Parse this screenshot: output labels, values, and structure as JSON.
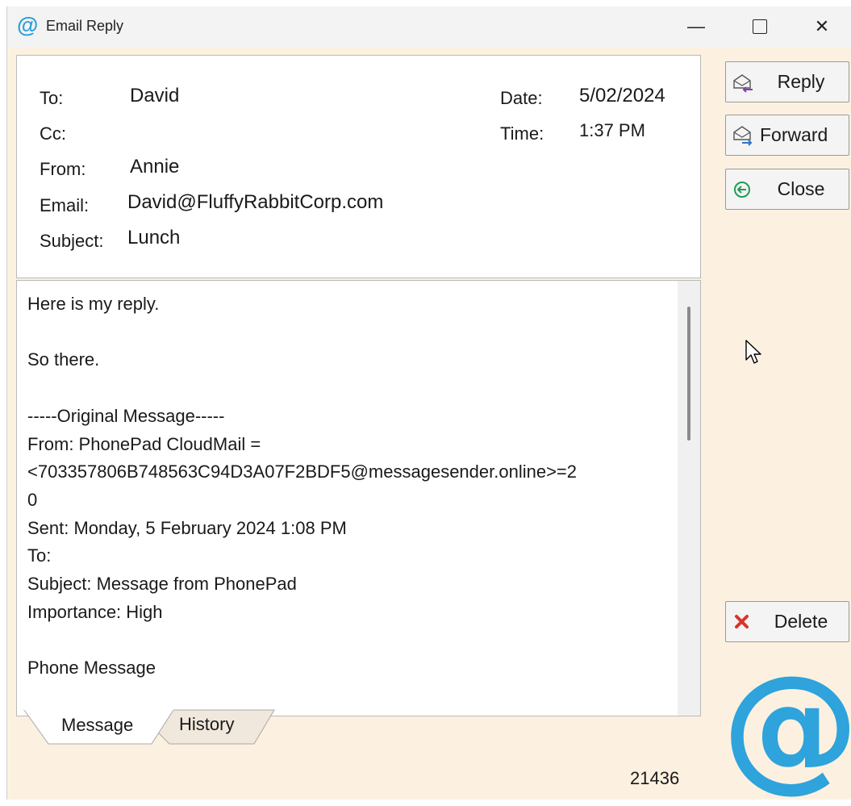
{
  "window": {
    "title": "Email Reply",
    "controls": {
      "minimize": "—",
      "close": "✕"
    }
  },
  "header": {
    "to_label": "To:",
    "to_value": "David",
    "cc_label": "Cc:",
    "cc_value": "",
    "from_label": "From:",
    "from_value": "Annie",
    "email_label": "Email:",
    "email_value": "David@FluffyRabbitCorp.com",
    "subject_label": "Subject:",
    "subject_value": "Lunch",
    "date_label": "Date:",
    "date_value": "5/02/2024",
    "time_label": "Time:",
    "time_value": "1:37 PM"
  },
  "message": {
    "body": "Here is my reply.\n\nSo there.\n\n-----Original Message-----\nFrom: PhonePad CloudMail =\n<703357806B748563C94D3A07F2BDF5@messagesender.online>=2\n0\nSent: Monday, 5 February 2024 1:08 PM\nTo:\nSubject: Message from PhonePad\nImportance: High\n\nPhone Message"
  },
  "tabs": [
    {
      "label": "Message",
      "active": true
    },
    {
      "label": "History",
      "active": false
    }
  ],
  "actions": {
    "reply": "Reply",
    "forward": "Forward",
    "close": "Close",
    "delete": "Delete"
  },
  "icons": {
    "app": "at-sign-icon",
    "reply": "envelope-reply-icon",
    "forward": "envelope-forward-icon",
    "close": "circle-arrow-left-icon",
    "delete": "red-x-icon",
    "brand": "large-at-logo"
  },
  "colors": {
    "brand_blue": "#2ea3dc",
    "background": "#fcf1e1",
    "close_green": "#1f9d55",
    "delete_red": "#d9342b",
    "reply_purple": "#8a3ab9",
    "forward_blue": "#2e74c9"
  },
  "record_id": "21436"
}
